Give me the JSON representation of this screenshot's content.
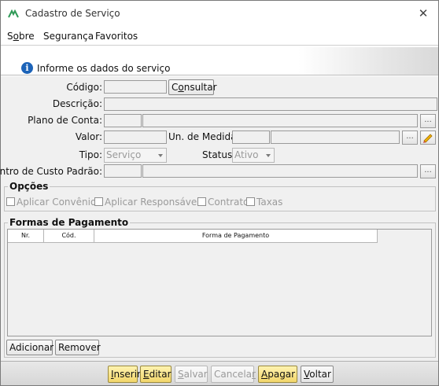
{
  "window": {
    "title": "Cadastro de Serviço",
    "close_icon": "close-icon",
    "app_icon": "app-logo-icon"
  },
  "menu": {
    "items": [
      {
        "label": "Sobre",
        "mnemonic": "o"
      },
      {
        "label": "Segurança"
      },
      {
        "label": "Favoritos"
      }
    ]
  },
  "banner": {
    "icon": "info-icon",
    "text": "Informe os dados do serviço"
  },
  "form": {
    "codigo_label": "Código:",
    "codigo_value": "",
    "consultar_button": "Consultar",
    "descricao_label": "Descrição:",
    "descricao_value": "",
    "plano_conta_label": "Plano de Conta:",
    "valor_label": "Valor:",
    "valor_value": "",
    "un_medida_label": "Un. de Medida:",
    "tipo_label": "Tipo:",
    "tipo_value": "Serviço",
    "status_label": "Status:",
    "status_value": "Ativo",
    "centro_custo_label": "Centro de Custo Padrão:",
    "ellipsis": "..."
  },
  "opcoes": {
    "title": "Opções",
    "checkboxes": [
      {
        "label": "Aplicar Convênios",
        "checked": false
      },
      {
        "label": "Aplicar Responsáveis",
        "checked": false
      },
      {
        "label": "Contrato",
        "checked": false
      },
      {
        "label": "Taxas",
        "checked": false
      }
    ]
  },
  "formas_pagamento": {
    "title": "Formas de Pagamento",
    "columns": [
      "Nr.",
      "Cód.",
      "Forma de Pagamento"
    ],
    "rows": [],
    "adicionar_button": "Adicionar",
    "remover_button": "Remover"
  },
  "toolbar": {
    "inserir": "Inserir",
    "editar": "Editar",
    "salvar": "Salvar",
    "cancelar": "Cancelar",
    "apagar": "Apagar",
    "voltar": "Voltar"
  },
  "colors": {
    "highlight_button": "#f2d66a",
    "info_icon": "#1c63b8",
    "app_icon": "#2f9a57"
  }
}
